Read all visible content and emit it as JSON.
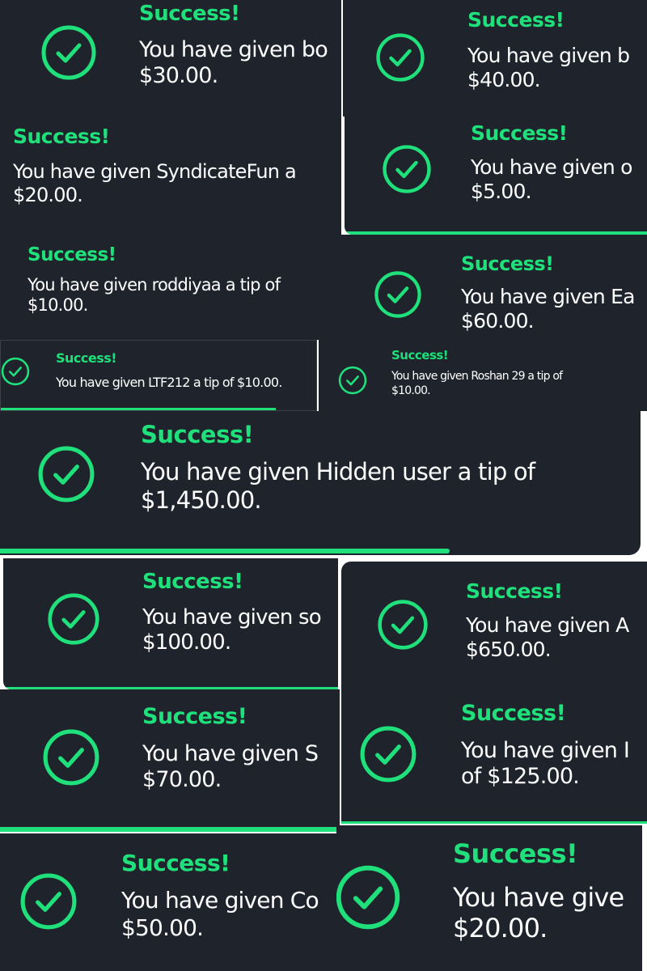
{
  "accent": "#1fe07a",
  "panel_bg": "#1e232c",
  "icons": {
    "success": "check-circle-icon"
  },
  "toasts": [
    {
      "title": "Success!",
      "line1": "You have given bo",
      "line2": "$30.00."
    },
    {
      "title": "Success!",
      "line1": "You have given b",
      "line2": "$40.00."
    },
    {
      "title": "Success!",
      "line1": "You have given SyndicateFun a",
      "line2": "$20.00."
    },
    {
      "title": "Success!",
      "line1": "You have given o",
      "line2": "$5.00."
    },
    {
      "title": "Success!",
      "line1": "You have given roddiyaa a tip of",
      "line2": "$10.00."
    },
    {
      "title": "Success!",
      "line1": "You have given Ea",
      "line2": "$60.00."
    },
    {
      "title": "Success!",
      "line1": "You have given LTF212 a tip of $10.00.",
      "line2": ""
    },
    {
      "title": "Success!",
      "line1": "You have given Roshan 29 a tip of",
      "line2": "$10.00."
    },
    {
      "title": "Success!",
      "line1": "You have given Hidden user a tip of",
      "line2": "$1,450.00."
    },
    {
      "title": "Success!",
      "line1": "You have given so",
      "line2": "$100.00."
    },
    {
      "title": "Success!",
      "line1": "You have given A",
      "line2": "$650.00."
    },
    {
      "title": "Success!",
      "line1": "You have given S",
      "line2": "$70.00."
    },
    {
      "title": "Success!",
      "line1": "You have given I",
      "line2": "of $125.00."
    },
    {
      "title": "Success!",
      "line1": "You have given Co",
      "line2": "$50.00."
    },
    {
      "title": "Success!",
      "line1": "You have give",
      "line2": "$20.00."
    }
  ]
}
